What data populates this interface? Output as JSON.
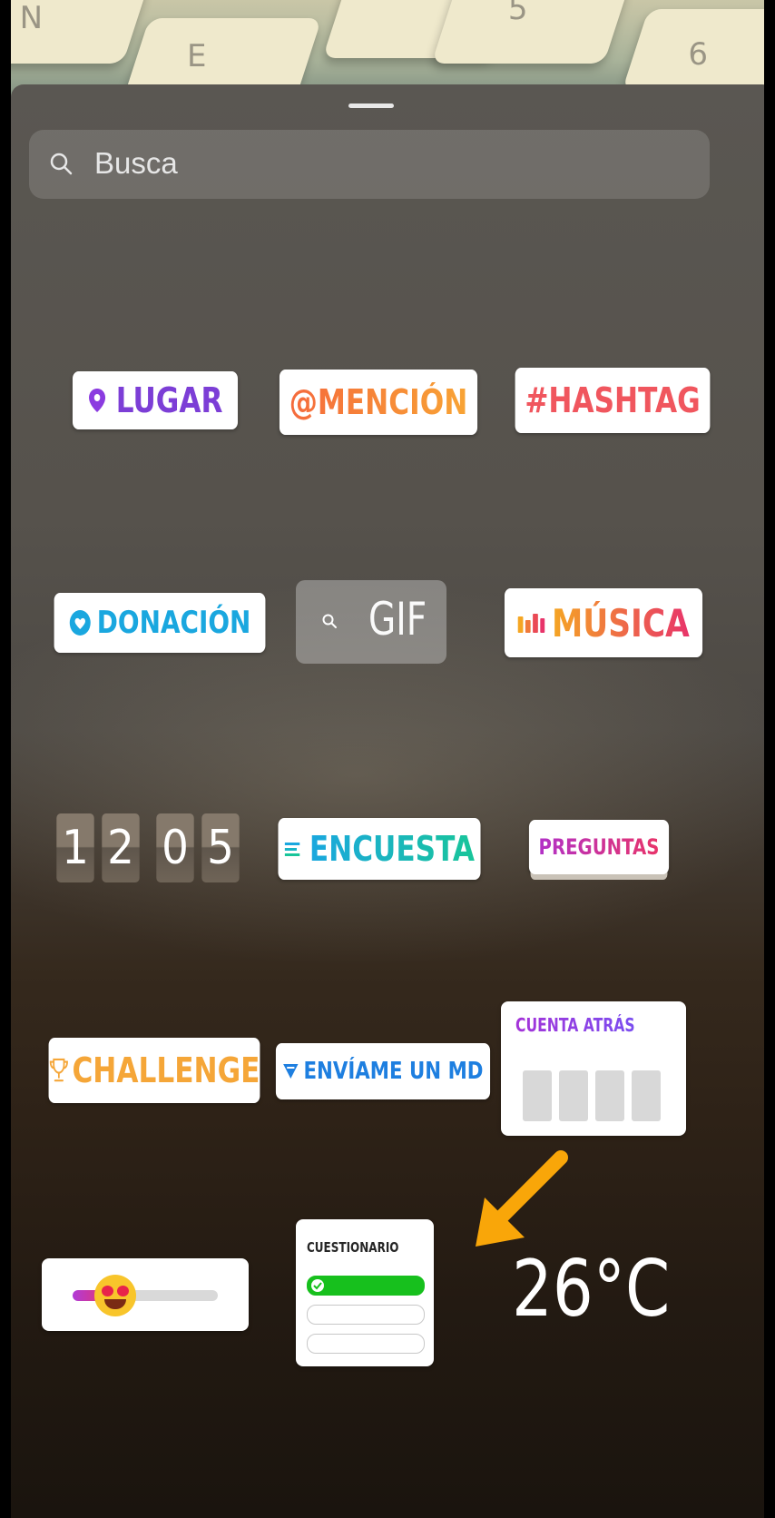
{
  "search": {
    "placeholder": "Busca"
  },
  "stickers": {
    "location": "LUGAR",
    "mention": "@MENCIÓN",
    "hashtag": "#HASHTAG",
    "donation": "DONACIÓN",
    "gif": "GIF",
    "music": "MÚSICA",
    "clock_digits": [
      "1",
      "2",
      "0",
      "5"
    ],
    "poll": "ENCUESTA",
    "questions": "PREGUNTAS",
    "challenge": "CHALLENGE",
    "dm": "ENVÍAME UN MD",
    "countdown": "CUENTA ATRÁS",
    "quiz": "CUESTIONARIO",
    "temperature": "26°C"
  },
  "background_keys": [
    "N",
    "E",
    "5",
    "6"
  ],
  "icons": {
    "search": "search-icon",
    "location": "map-pin-icon",
    "donation": "heart-icon",
    "gif_search": "search-icon",
    "music": "audio-bars-icon",
    "poll": "list-icon",
    "challenge": "trophy-icon",
    "dm": "send-icon",
    "arrow": "arrow-annotation-icon"
  },
  "colors": {
    "accent_arrow": "#f9a609",
    "quiz_correct": "#17c01d"
  }
}
